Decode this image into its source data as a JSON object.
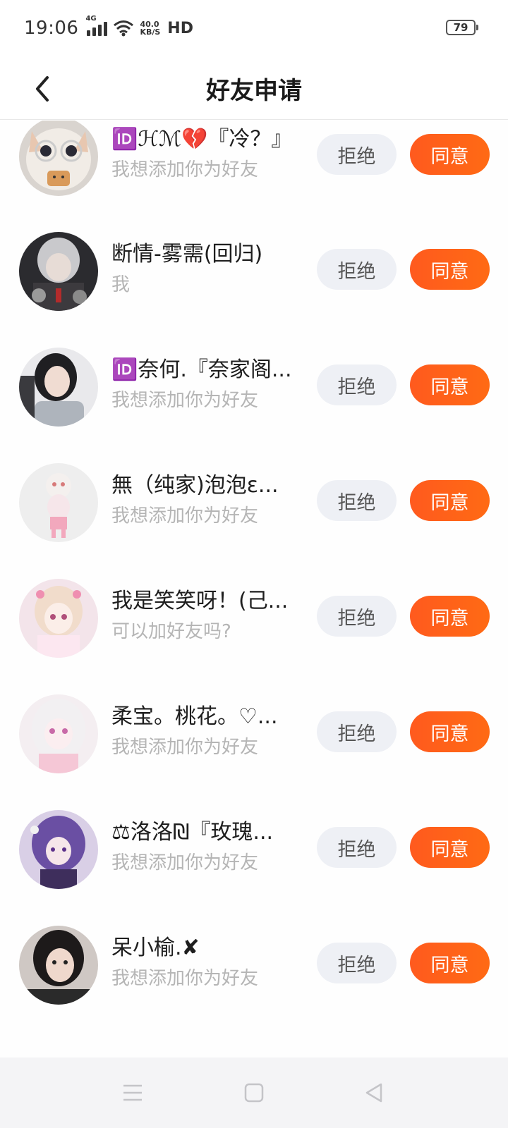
{
  "status_bar": {
    "time": "19:06",
    "network": "4G",
    "speed_value": "40.0",
    "speed_unit": "KB/S",
    "hd": "HD",
    "battery": "79"
  },
  "header": {
    "title": "好友申请"
  },
  "buttons": {
    "reject_label": "拒绝",
    "accept_label": "同意"
  },
  "requests": [
    {
      "name": "🆔ℋℳ💔『冷？』",
      "message": "我想添加你为好友",
      "avatar": "cat-with-glasses"
    },
    {
      "name": "断情-雾需(回归)",
      "message": "我",
      "avatar": "dark-anime-character"
    },
    {
      "name": "🆔奈何.『奈家阁...",
      "message": "我想添加你为好友",
      "avatar": "girl-dark-hair"
    },
    {
      "name": "無（纯家)泡泡ε...",
      "message": "我想添加你为好友",
      "avatar": "chibi-doll-pink"
    },
    {
      "name": "我是笑笑呀！(己...",
      "message": "可以加好友吗?",
      "avatar": "anime-girl-pink"
    },
    {
      "name": "柔宝。桃花。♡...",
      "message": "我想添加你为好友",
      "avatar": "anime-girl-white-hair"
    },
    {
      "name": "⚖洛洛₪『玫瑰...",
      "message": "我想添加你为好友",
      "avatar": "anime-girl-purple"
    },
    {
      "name": "呆小榆.✘",
      "message": "我想添加你为好友",
      "avatar": "girl-photo"
    }
  ],
  "colors": {
    "accent": "#ff5a1e",
    "reject_bg": "#eef0f5",
    "secondary_text": "#b5b5b5"
  }
}
